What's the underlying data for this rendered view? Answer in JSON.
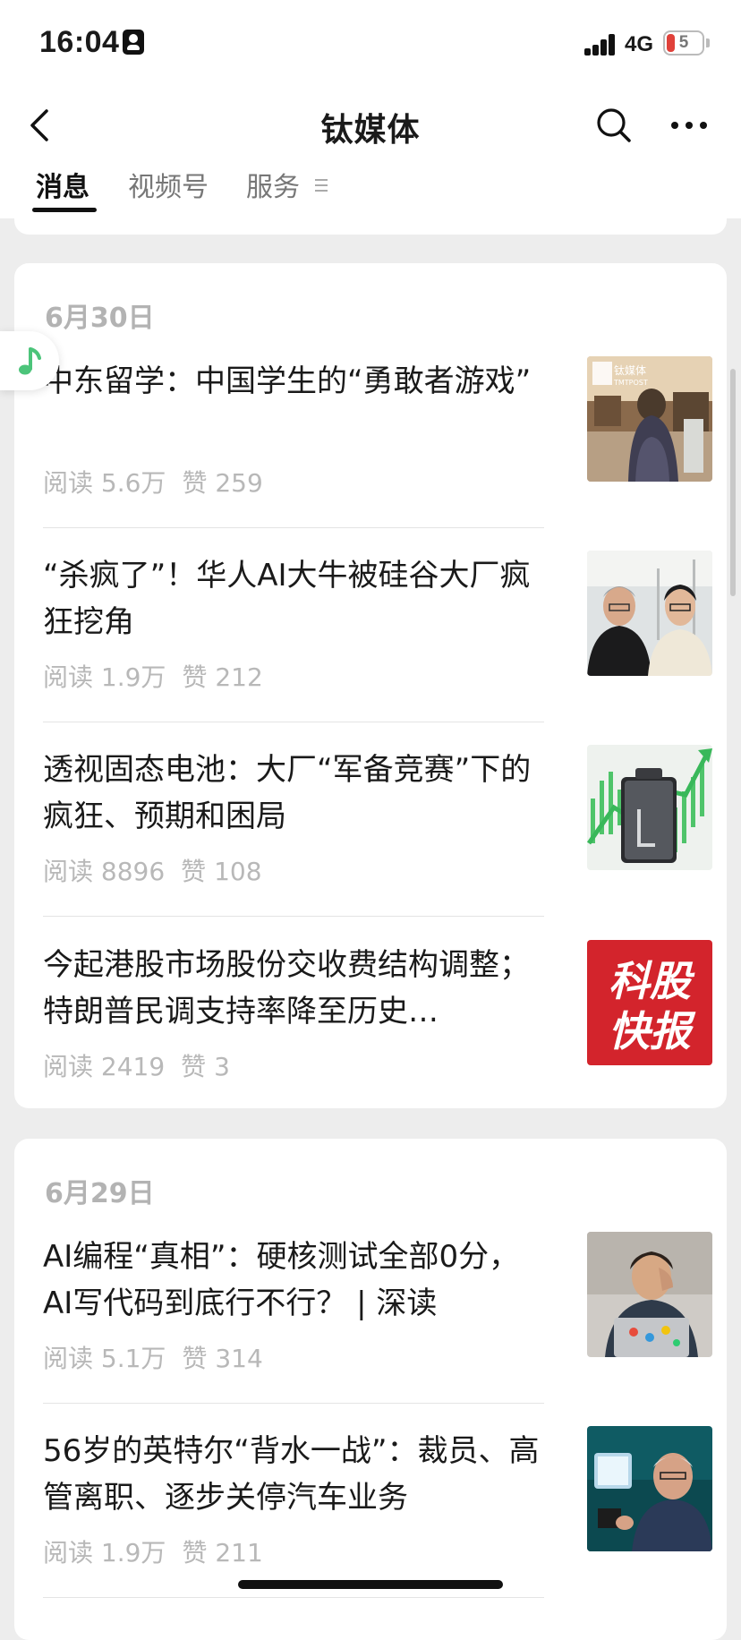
{
  "status": {
    "time": "16:04",
    "network": "4G",
    "battery": "5"
  },
  "nav": {
    "title": "钛媒体"
  },
  "tabs": [
    {
      "label": "消息",
      "active": true
    },
    {
      "label": "视频号",
      "active": false
    },
    {
      "label": "服务",
      "active": false
    }
  ],
  "groups": [
    {
      "date": "6月30日",
      "articles": [
        {
          "title": "中东留学：中国学生的“勇敢者游戏”",
          "reads": "阅读 5.6万",
          "likes": "赞 259",
          "thumb": "students-walking"
        },
        {
          "title": "“杀疯了”！华人AI大牛被硅谷大厂疯狂挖角",
          "reads": "阅读 1.9万",
          "likes": "赞 212",
          "thumb": "two-men-photo"
        },
        {
          "title": "透视固态电池：大厂“军备竞赛”下的疯狂、预期和困局",
          "reads": "阅读 8896",
          "likes": "赞 108",
          "thumb": "battery-chart"
        },
        {
          "title": "今起港股市场股份交收费结构调整；特朗普民调支持率降至历史…",
          "reads": "阅读 2419",
          "likes": "赞 3",
          "thumb": "news-flash"
        }
      ]
    },
    {
      "date": "6月29日",
      "articles": [
        {
          "title": "AI编程“真相”：硬核测试全部0分，AI写代码到底行不行？ | 深读",
          "reads": "阅读 5.1万",
          "likes": "赞 314",
          "thumb": "coder-laptop"
        },
        {
          "title": "56岁的英特尔“背水一战”：裁员、高管离职、逐步关停汽车业务",
          "reads": "阅读 1.9万",
          "likes": "赞 211",
          "thumb": "exec-with-chip"
        }
      ]
    }
  ],
  "thumb_text": {
    "brand": "钛媒体",
    "brand_en": "TMTPOST",
    "flash_line1": "科股",
    "flash_line2": "快报"
  },
  "colors": {
    "flash_red": "#d3242c",
    "music_green": "#4cc47a"
  }
}
